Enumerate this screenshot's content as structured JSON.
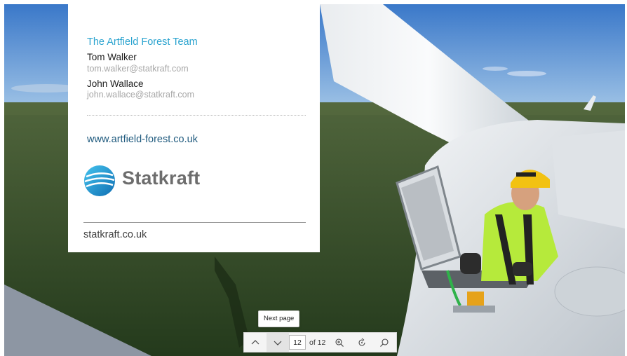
{
  "card": {
    "team_title": "The Artfield Forest Team",
    "contacts": [
      {
        "name": "Tom Walker",
        "email": "tom.walker@statkraft.com"
      },
      {
        "name": "John Wallace",
        "email": "john.wallace@statkraft.com"
      }
    ],
    "website": "www.artfield-forest.co.uk",
    "logo_text": "Statkraft",
    "footer_url": "statkraft.co.uk"
  },
  "viewer": {
    "tooltip": "Next page",
    "current_page": "12",
    "page_of": "of 12",
    "icons": [
      "chevron-up-icon",
      "chevron-down-icon",
      "zoom-in-icon",
      "rotate-icon",
      "search-icon"
    ]
  },
  "colors": {
    "accent_blue": "#2aa3cf",
    "link_blue": "#1f5a7e",
    "email_gray": "#a7a7a7",
    "logo_gray": "#6d6d6d"
  }
}
